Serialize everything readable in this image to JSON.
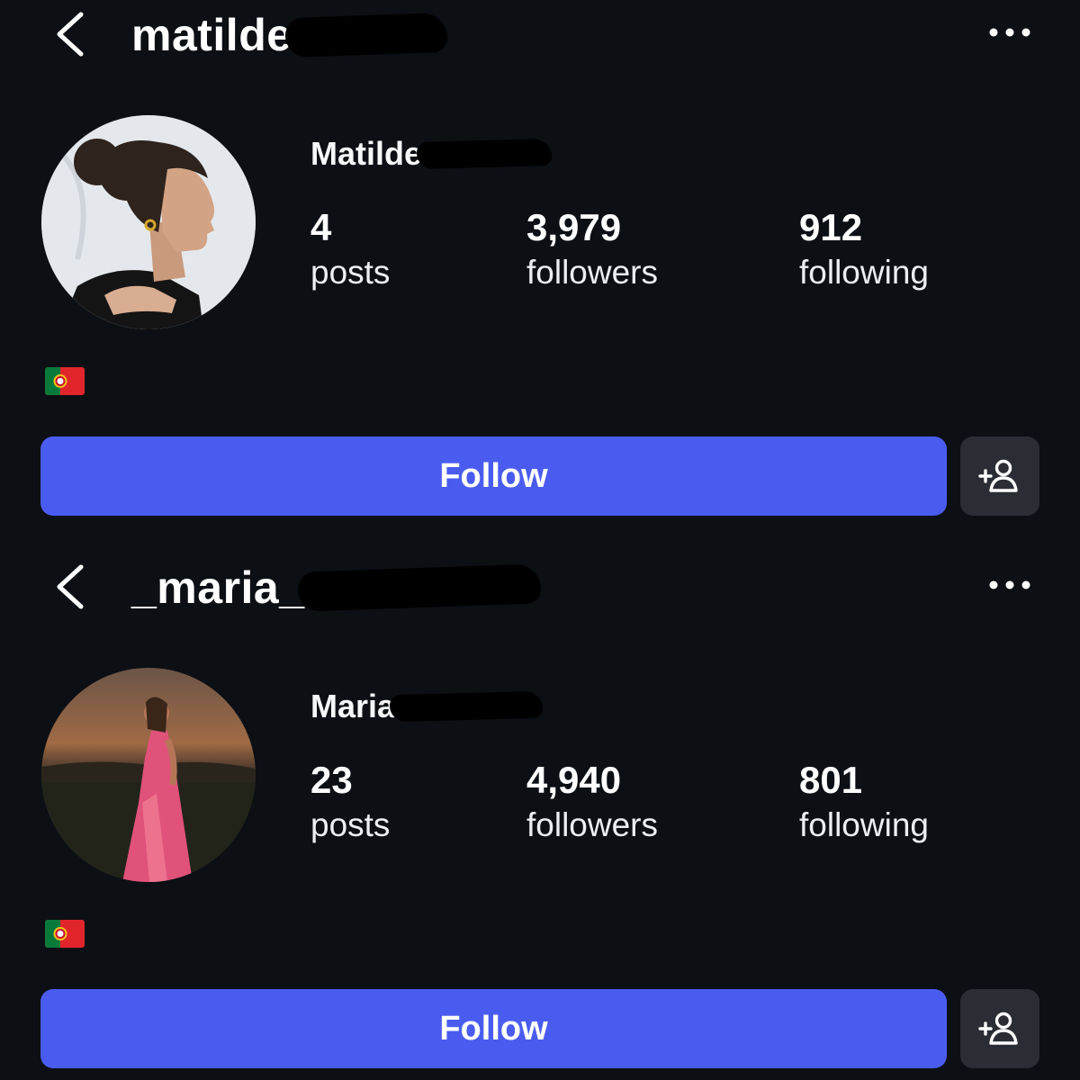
{
  "profiles": [
    {
      "username": "matilde",
      "display_name": "Matilde",
      "posts_count": "4",
      "posts_label": "posts",
      "followers_count": "3,979",
      "followers_label": "followers",
      "following_count": "912",
      "following_label": "following",
      "bio_flag": "portugal-flag",
      "follow_label": "Follow",
      "avatar_scene": "studio-portrait"
    },
    {
      "username": "_maria_",
      "display_name": "Maria",
      "posts_count": "23",
      "posts_label": "posts",
      "followers_count": "4,940",
      "followers_label": "followers",
      "following_count": "801",
      "following_label": "following",
      "bio_flag": "portugal-flag",
      "follow_label": "Follow",
      "avatar_scene": "sunset-field"
    }
  ],
  "icons": {
    "back": "chevron-left-icon",
    "more": "more-horizontal-icon",
    "add_person": "add-person-icon"
  },
  "colors": {
    "background": "#0c0f14",
    "follow_button": "#4a5cf0",
    "secondary_button": "#2a2d33",
    "text": "#ffffff"
  }
}
